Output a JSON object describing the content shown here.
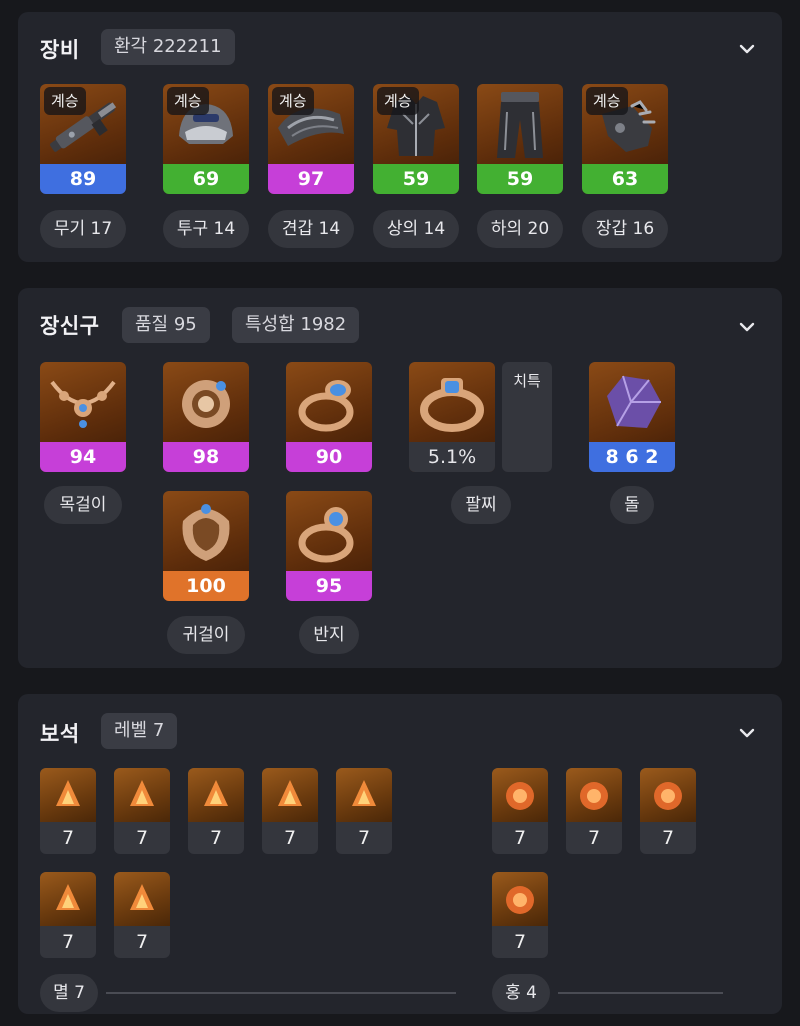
{
  "equipment": {
    "title": "장비",
    "tag": "환각 222211",
    "items": [
      {
        "badge": "계승",
        "value": "89",
        "label": "무기 17",
        "color": "#3f6fe0"
      },
      {
        "badge": "계승",
        "value": "69",
        "label": "투구 14",
        "color": "#43b032"
      },
      {
        "badge": "계승",
        "value": "97",
        "label": "견갑 14",
        "color": "#c63fd8"
      },
      {
        "badge": "계승",
        "value": "59",
        "label": "상의 14",
        "color": "#43b032"
      },
      {
        "badge": "",
        "value": "59",
        "label": "하의 20",
        "color": "#43b032"
      },
      {
        "badge": "계승",
        "value": "63",
        "label": "장갑 16",
        "color": "#43b032"
      }
    ]
  },
  "accessories": {
    "title": "장신구",
    "tag1": "품질 95",
    "tag2": "특성합 1982",
    "necklace": {
      "value": "94",
      "label": "목걸이"
    },
    "earring1": {
      "value": "98"
    },
    "earring2": {
      "value": "100"
    },
    "earring_label": "귀걸이",
    "ring1": {
      "value": "90"
    },
    "ring2": {
      "value": "95"
    },
    "ring_label": "반지",
    "bracelet": {
      "value": "5.1%",
      "stat": "치특",
      "label": "팔찌"
    },
    "stone": {
      "value": "8 6 2",
      "label": "돌"
    }
  },
  "gems": {
    "title": "보석",
    "tag": "레벨 7",
    "left_values": [
      "7",
      "7",
      "7",
      "7",
      "7",
      "7",
      "7"
    ],
    "right_values": [
      "7",
      "7",
      "7",
      "7"
    ],
    "left_label": "멸 7",
    "right_label": "홍 4"
  }
}
